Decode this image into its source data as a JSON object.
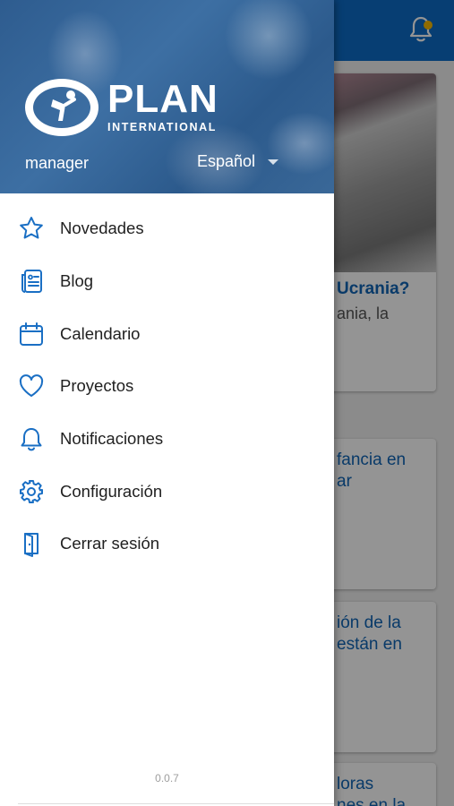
{
  "drawer": {
    "brand": {
      "name": "PLAN",
      "subtitle": "INTERNATIONAL"
    },
    "user_name": "manager",
    "language": "Español",
    "menu": [
      {
        "label": "Novedades",
        "icon": "star-icon"
      },
      {
        "label": "Blog",
        "icon": "blog-icon"
      },
      {
        "label": "Calendario",
        "icon": "calendar-icon"
      },
      {
        "label": "Proyectos",
        "icon": "heart-icon"
      },
      {
        "label": "Notificaciones",
        "icon": "bell-icon"
      },
      {
        "label": "Configuración",
        "icon": "gear-icon"
      },
      {
        "label": "Cerrar sesión",
        "icon": "door-icon"
      }
    ],
    "version": "0.0.7"
  },
  "background": {
    "card1": {
      "title": "Ucrania?",
      "subtitle": "ania, la"
    },
    "card2": {
      "line1": "fancia en",
      "line2": "ar"
    },
    "card3": {
      "line1": "ión de la",
      "line2": "están en"
    },
    "card4": {
      "line1": "loras",
      "line2": "nes en la"
    }
  },
  "colors": {
    "accent": "#0d6bc7",
    "icon": "#1a6fc4",
    "notification_dot": "#f5b800"
  }
}
